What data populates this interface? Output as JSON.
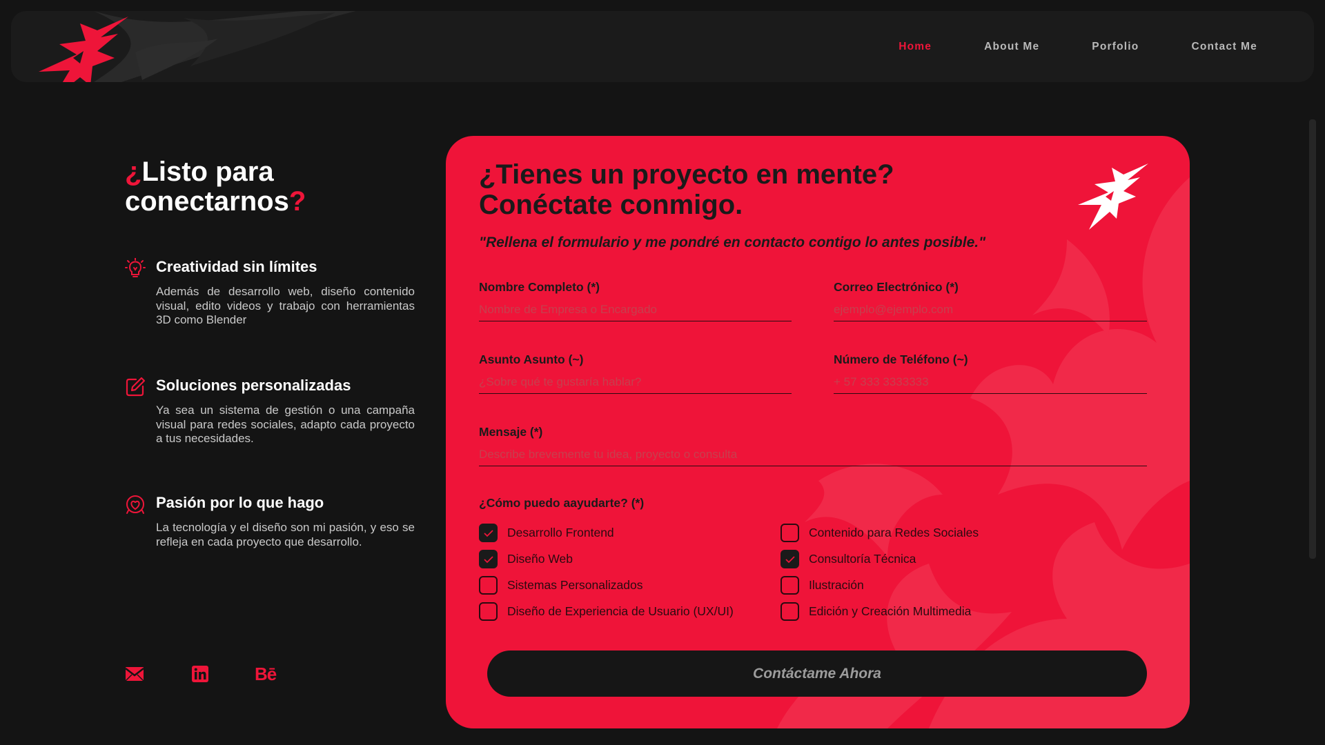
{
  "colors": {
    "accent": "#ee1539",
    "background": "#141414",
    "card": "#ef1439",
    "dark": "#1a1a1a"
  },
  "nav": {
    "logo_icon": "brand-star-logo",
    "links": [
      {
        "label": "Home",
        "active": true
      },
      {
        "label": "About Me",
        "active": false
      },
      {
        "label": "Porfolio",
        "active": false
      },
      {
        "label": "Contact Me",
        "active": false
      }
    ]
  },
  "left": {
    "title_q_open": "¿",
    "title_main": "Listo para conectarnos",
    "title_q_close": "?",
    "features": [
      {
        "icon": "lightbulb-icon",
        "title": "Creatividad sin límites",
        "description": "Además de desarrollo web, diseño contenido visual, edito videos y trabajo con herramientas 3D como Blender"
      },
      {
        "icon": "edit-icon",
        "title": "Soluciones personalizadas",
        "description": "Ya sea un sistema de gestión o una campaña visual para redes sociales, adapto cada proyecto a tus necesidades."
      },
      {
        "icon": "passion-icon",
        "title": "Pasión por lo que hago",
        "description": "La tecnología y el diseño son mi pasión, y eso se refleja en cada proyecto que desarrollo."
      }
    ],
    "socials": [
      {
        "icon": "mail-icon"
      },
      {
        "icon": "linkedin-icon"
      },
      {
        "icon": "behance-icon",
        "label": "Bē"
      }
    ]
  },
  "form": {
    "title_line1": "¿Tienes un proyecto en mente?",
    "title_line2": "Conéctate conmigo.",
    "quote": "\"Rellena el formulario y me pondré en contacto contigo lo antes posible.\"",
    "fields": {
      "name": {
        "label": "Nombre Completo (*)",
        "placeholder": "Nombre de Empresa o Encargado",
        "value": ""
      },
      "email": {
        "label": "Correo Electrónico (*)",
        "placeholder": "ejemplo@ejemplo.com",
        "value": ""
      },
      "subject": {
        "label": "Asunto Asunto (~)",
        "placeholder": "¿Sobre qué te gustaría hablar?",
        "value": ""
      },
      "phone": {
        "label": "Número de Teléfono (~)",
        "placeholder": "+ 57 333 3333333",
        "value": ""
      },
      "message": {
        "label": "Mensaje (*)",
        "placeholder": "Describe brevemente tu idea, proyecto o consulta",
        "value": ""
      }
    },
    "help_label": "¿Cómo puedo aayudarte? (*)",
    "options_left": [
      {
        "label": "Desarrollo Frontend",
        "checked": true
      },
      {
        "label": "Diseño Web",
        "checked": true
      },
      {
        "label": "Sistemas Personalizados",
        "checked": false
      },
      {
        "label": "Diseño de Experiencia de Usuario (UX/UI)",
        "checked": false
      }
    ],
    "options_right": [
      {
        "label": "Contenido para Redes Sociales",
        "checked": false
      },
      {
        "label": "Consultoría Técnica",
        "checked": true
      },
      {
        "label": "Ilustración",
        "checked": false
      },
      {
        "label": "Edición y Creación Multimedia",
        "checked": false
      }
    ],
    "submit_label": "Contáctame Ahora"
  }
}
